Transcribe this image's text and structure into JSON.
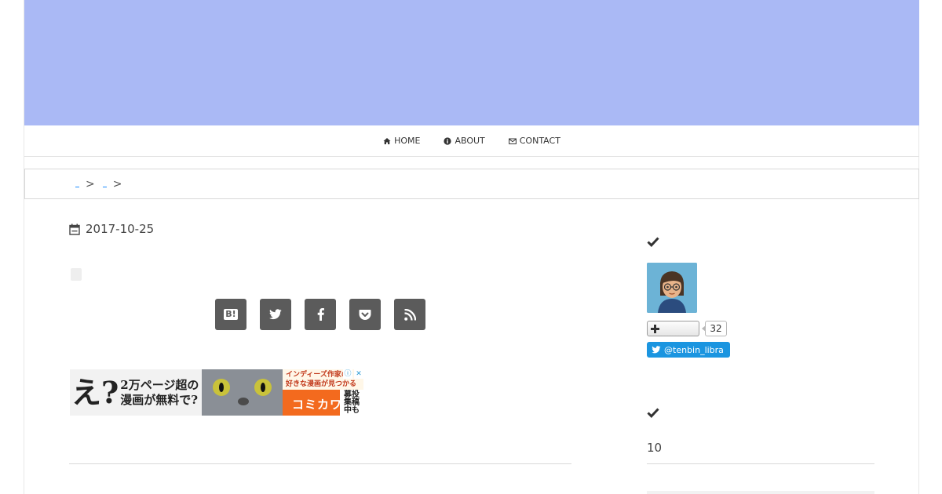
{
  "nav": {
    "items": [
      {
        "label": "HOME",
        "icon": "home-icon"
      },
      {
        "label": "ABOUT",
        "icon": "info-icon"
      },
      {
        "label": "CONTACT",
        "icon": "envelope-icon"
      }
    ]
  },
  "breadcrumb": {
    "separators": [
      ">",
      ">"
    ]
  },
  "post": {
    "date": "2017-10-25"
  },
  "share": {
    "buttons": [
      {
        "label": "B!",
        "icon": "hatena-bookmark-icon"
      },
      {
        "label": "",
        "icon": "twitter-icon"
      },
      {
        "label": "",
        "icon": "facebook-icon"
      },
      {
        "label": "",
        "icon": "pocket-icon"
      },
      {
        "label": "",
        "icon": "rss-icon"
      }
    ]
  },
  "ad": {
    "headline_big": "え?",
    "headline_line1": "2万ページ超の",
    "headline_line2": "漫画が無料で?",
    "right_top_line1": "インディーズ作家の",
    "right_top_line2": "好きな漫画が見つかる",
    "logo": "コミカワ",
    "badge_line1": "募投",
    "badge_line2": "集稿",
    "badge_line3": "中も",
    "info_glyph": "ⓘ",
    "close_glyph": "✕"
  },
  "sidebar": {
    "follow_count": "32",
    "twitter_handle": "@tenbin_libra",
    "count_value": "10"
  },
  "colors": {
    "header_banner": "#aab9f5",
    "share_button": "#5b5b5b",
    "twitter_blue": "#1b95e0",
    "link_blue": "#1a8cff"
  }
}
